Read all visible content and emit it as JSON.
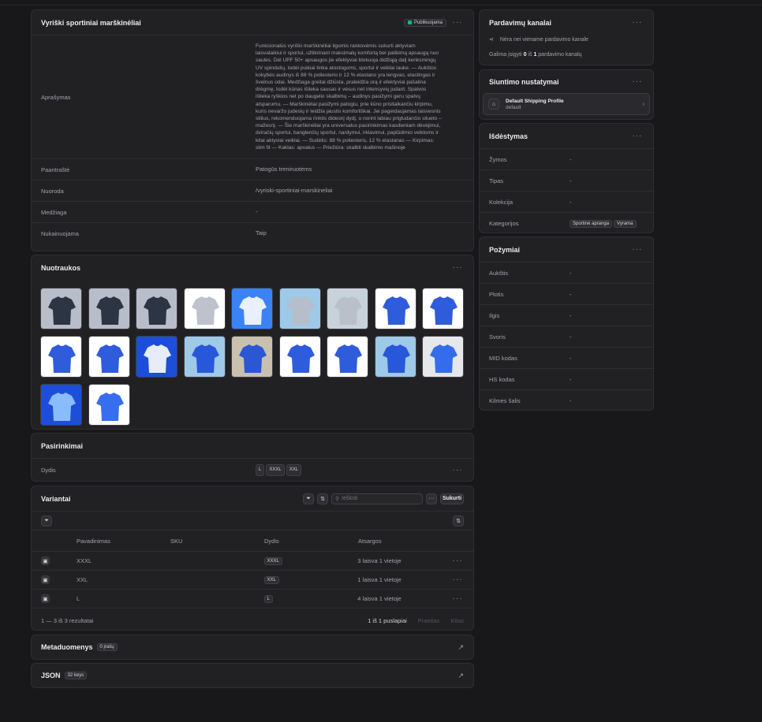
{
  "product": {
    "title": "Vyriški sportiniai marškinėliai",
    "status": "Publikuojama",
    "fields": [
      {
        "label": "Aprašymas",
        "value": "Funkcionalūs vyriški marškinėliai ilgomis rankovėmis sukurti aktyviam laisvalaikiui ir sportui, užtikrinant maksimalų komfortą bei patikimą apsaugą nuo saulės. Dėl UPF 50+ apsaugos jie efektyviai blokuoja didžiąją dalį kenksmingų UV spindulių, todėl puikiai tinka atostogoms, sportui ir veiklai lauke. — Aukštos kokybės audinys iš 88 % poliesterio ir 12 % elastano yra lengvas, elastingas ir švelnus odai. Medžiaga greitai džiūsta, praleidžia orą ir efektyviai pašalina drėgmę, todėl kūnas išlieka sausas ir vėsus net intensyvių judant. Spalvos išlieka ryškios net po daugelio skalbimų – audinys pasižymi geru spalvų atsparumu. — Marškinėliai pasižymi patogiu, prie kūno prisitaikančiu kirpimu, kuris nevaržo judesių ir leidžia jaustis komfortiškai. Jei pageidaujamas laisvesnis stilius, rekomenduojama rinktis didesnį dydį, o norint labiau prigludančio silueto – mažesnį. — Šie marškinėliai yra universalus pasirinkimas kasdieniam dėvėjimui, dviračių sportui, banglenčių sportui, nardymui, irklavimui, paplūdimio veikloms ir kitai aktyviai veiklai. — Sudėtis: 88 % poliesteris, 12 % elastanas — Kirpimas: slim fit — Kaklas: apvalus — Priežiūra: skalbti skalbimo mašinoje"
      },
      {
        "label": "Paantraštė",
        "value": "Patogūs treniruotėms"
      },
      {
        "label": "Nuoroda",
        "value": "/vyriski-sportiniai-marskineliai"
      },
      {
        "label": "Medžiaga",
        "value": "-"
      },
      {
        "label": "Nukainuojama",
        "value": "Taip"
      }
    ]
  },
  "photos": {
    "title": "Nuotraukos",
    "count": 20
  },
  "options": {
    "title": "Pasirinkimai",
    "label": "Dydis",
    "values": [
      "L",
      "XXXL",
      "XXL"
    ]
  },
  "variants": {
    "title": "Variantai",
    "search_placeholder": "Ieškoti",
    "create_label": "Sukurti",
    "columns": [
      "Pavadinimas",
      "SKU",
      "Dydis",
      "Atsargos"
    ],
    "rows": [
      {
        "name": "XXXL",
        "sku": "",
        "size": "XXXL",
        "stock": "3 laisva 1 vietoje"
      },
      {
        "name": "XXL",
        "sku": "",
        "size": "XXL",
        "stock": "1 laisva 1 vietoje"
      },
      {
        "name": "L",
        "sku": "",
        "size": "L",
        "stock": "4 laisva 1 vietoje"
      }
    ],
    "results": "1 — 3 iš 3 rezultatai",
    "pages": "1 iš 1 puslapiai",
    "prev": "Praeitas",
    "next": "Kitas"
  },
  "metadata": {
    "title": "Metaduomenys",
    "badge": "0 įrašų"
  },
  "json": {
    "title": "JSON",
    "badge": "32 keys"
  },
  "sales": {
    "title": "Pardavimų kanalai",
    "empty": "Nėra nei viename pardavimo kanale",
    "avail_pre": "Galima įsigyti ",
    "avail_a": "0",
    "avail_mid": " iš ",
    "avail_b": "1",
    "avail_post": " pardavimo kanalų"
  },
  "shipping": {
    "title": "Siuntimo nustatymai",
    "profile": "Default Shipping Profile",
    "sub": "default"
  },
  "org": {
    "title": "Išdėstymas",
    "rows": [
      {
        "label": "Žymos",
        "value": "-"
      },
      {
        "label": "Tipas",
        "value": "-"
      },
      {
        "label": "Kolekcija",
        "value": "-"
      },
      {
        "label": "Kategorijos",
        "tags": [
          "Sportinė apranga",
          "Vyrama"
        ]
      }
    ]
  },
  "attrs": {
    "title": "Požymiai",
    "rows": [
      {
        "label": "Aukštis",
        "value": "-"
      },
      {
        "label": "Plotis",
        "value": "-"
      },
      {
        "label": "Ilgis",
        "value": "-"
      },
      {
        "label": "Svoris",
        "value": "-"
      },
      {
        "label": "MID kodas",
        "value": "-"
      },
      {
        "label": "HS kodas",
        "value": "-"
      },
      {
        "label": "Kilmės šalis",
        "value": "-"
      }
    ]
  }
}
